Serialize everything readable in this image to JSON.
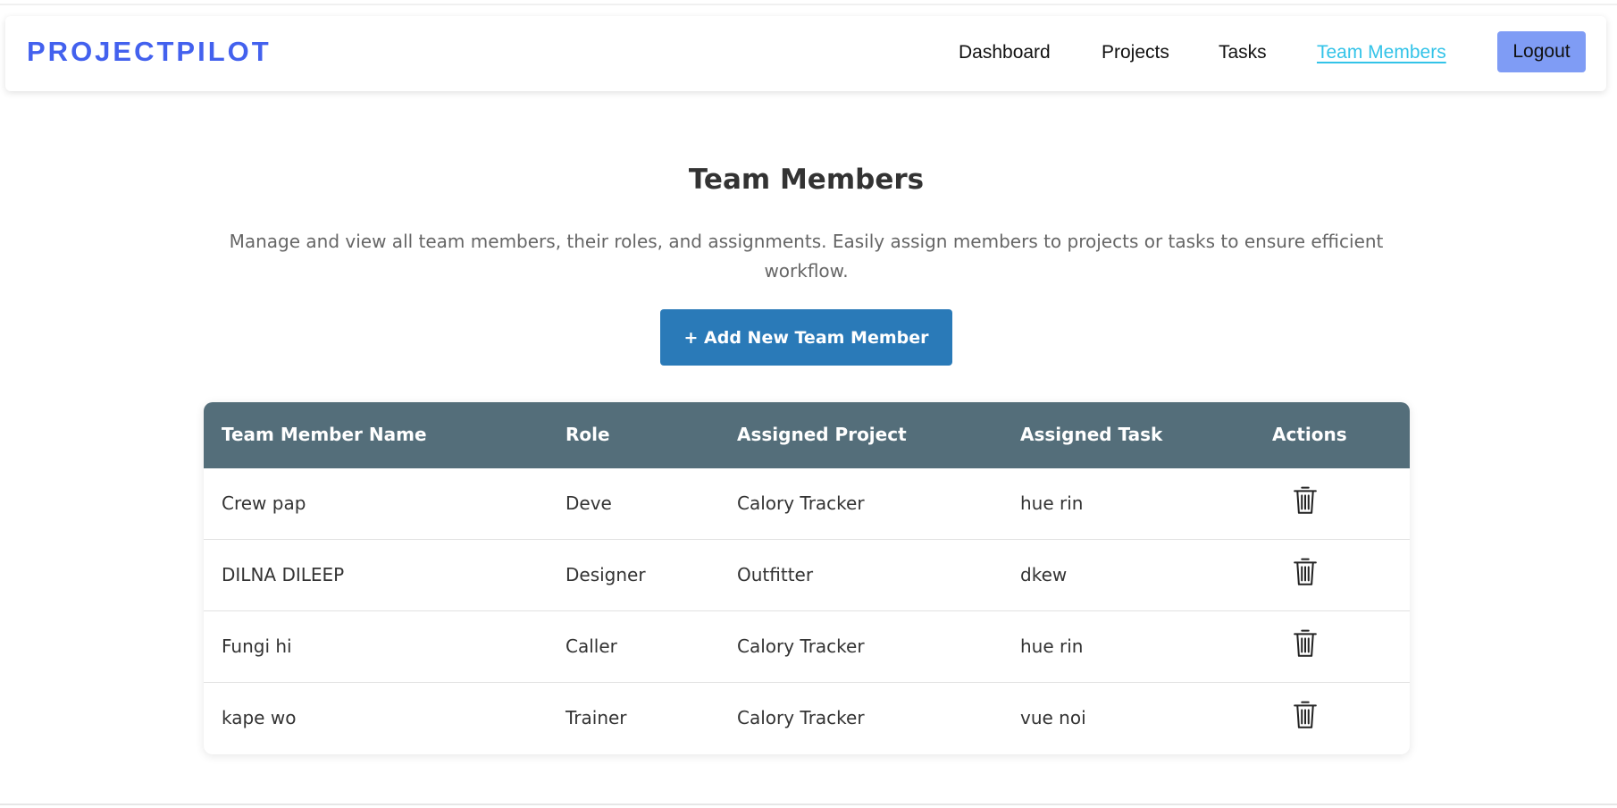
{
  "navbar": {
    "brand": "PROJECTPILOT",
    "links": [
      {
        "label": "Dashboard",
        "active": false
      },
      {
        "label": "Projects",
        "active": false
      },
      {
        "label": "Tasks",
        "active": false
      },
      {
        "label": "Team Members",
        "active": true
      }
    ],
    "logout_label": "Logout"
  },
  "main": {
    "title": "Team Members",
    "description": "Manage and view all team members, their roles, and assignments. Easily assign members to projects or tasks to ensure efficient workflow.",
    "add_button_label": "+ Add New Team Member"
  },
  "table": {
    "columns": [
      "Team Member Name",
      "Role",
      "Assigned Project",
      "Assigned Task",
      "Actions"
    ],
    "rows": [
      {
        "name": "Crew pap",
        "role": "Deve",
        "project": "Calory Tracker",
        "task": "hue rin",
        "action_icon": "trash-icon"
      },
      {
        "name": "DILNA DILEEP",
        "role": "Designer",
        "project": "Outfitter",
        "task": "dkew",
        "action_icon": "trash-icon"
      },
      {
        "name": "Fungi hi",
        "role": "Caller",
        "project": "Calory Tracker",
        "task": "hue rin",
        "action_icon": "trash-icon"
      },
      {
        "name": "kape wo",
        "role": "Trainer",
        "project": "Calory Tracker",
        "task": "vue noi",
        "action_icon": "trash-icon"
      }
    ]
  },
  "colors": {
    "brand": "#4361ee",
    "active_link": "#33c3e8",
    "logout_bg": "#7f9cf5",
    "add_button_bg": "#2a7ab8",
    "table_header_bg": "#546e7a",
    "title_text": "#333333",
    "desc_text": "#666666"
  }
}
